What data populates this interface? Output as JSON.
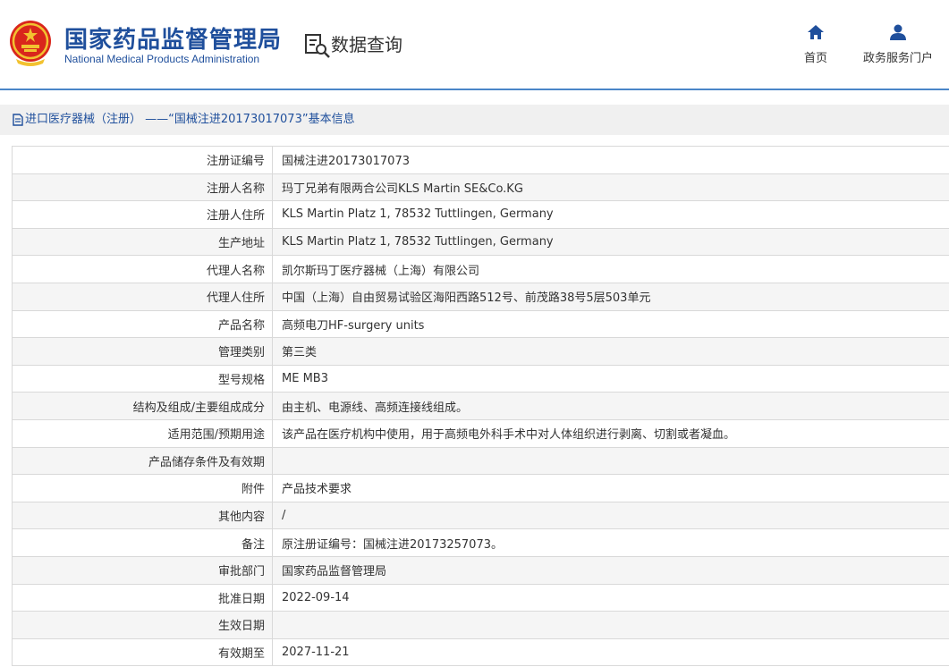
{
  "header": {
    "site_title_cn": "国家药品监督管理局",
    "site_title_en": "National Medical Products Administration",
    "section_title": "数据查询",
    "nav": [
      {
        "label": "首页",
        "icon": "home-icon"
      },
      {
        "label": "政务服务门户",
        "icon": "user-icon"
      }
    ],
    "accent_color": "#1f4f9c",
    "line_color": "#4a86c8"
  },
  "breadcrumb": {
    "icon": "document-icon",
    "text": "进口医疗器械（注册） ——“国械注进20173017073”基本信息"
  },
  "record": {
    "rows": [
      {
        "label": "注册证编号",
        "value": "国械注进20173017073"
      },
      {
        "label": "注册人名称",
        "value": "玛丁兄弟有限两合公司KLS Martin SE&Co.KG"
      },
      {
        "label": "注册人住所",
        "value": "KLS Martin Platz 1, 78532 Tuttlingen, Germany"
      },
      {
        "label": "生产地址",
        "value": "KLS Martin Platz 1, 78532 Tuttlingen, Germany"
      },
      {
        "label": "代理人名称",
        "value": "凯尔斯玛丁医疗器械（上海）有限公司"
      },
      {
        "label": "代理人住所",
        "value": "中国（上海）自由贸易试验区海阳西路512号、前茂路38号5层503单元"
      },
      {
        "label": "产品名称",
        "value": "高频电刀HF-surgery units"
      },
      {
        "label": "管理类别",
        "value": "第三类"
      },
      {
        "label": "型号规格",
        "value": "ME MB3"
      },
      {
        "label": "结构及组成/主要组成成分",
        "value": "由主机、电源线、高频连接线组成。"
      },
      {
        "label": "适用范围/预期用途",
        "value": "该产品在医疗机构中使用，用于高频电外科手术中对人体组织进行剥离、切割或者凝血。"
      },
      {
        "label": "产品储存条件及有效期",
        "value": ""
      },
      {
        "label": "附件",
        "value": "产品技术要求"
      },
      {
        "label": "其他内容",
        "value": "/"
      },
      {
        "label": "备注",
        "value": "原注册证编号：国械注进20173257073。"
      },
      {
        "label": "审批部门",
        "value": "国家药品监督管理局"
      },
      {
        "label": "批准日期",
        "value": "2022-09-14"
      },
      {
        "label": "生效日期",
        "value": ""
      },
      {
        "label": "有效期至",
        "value": "2027-11-21"
      }
    ]
  }
}
